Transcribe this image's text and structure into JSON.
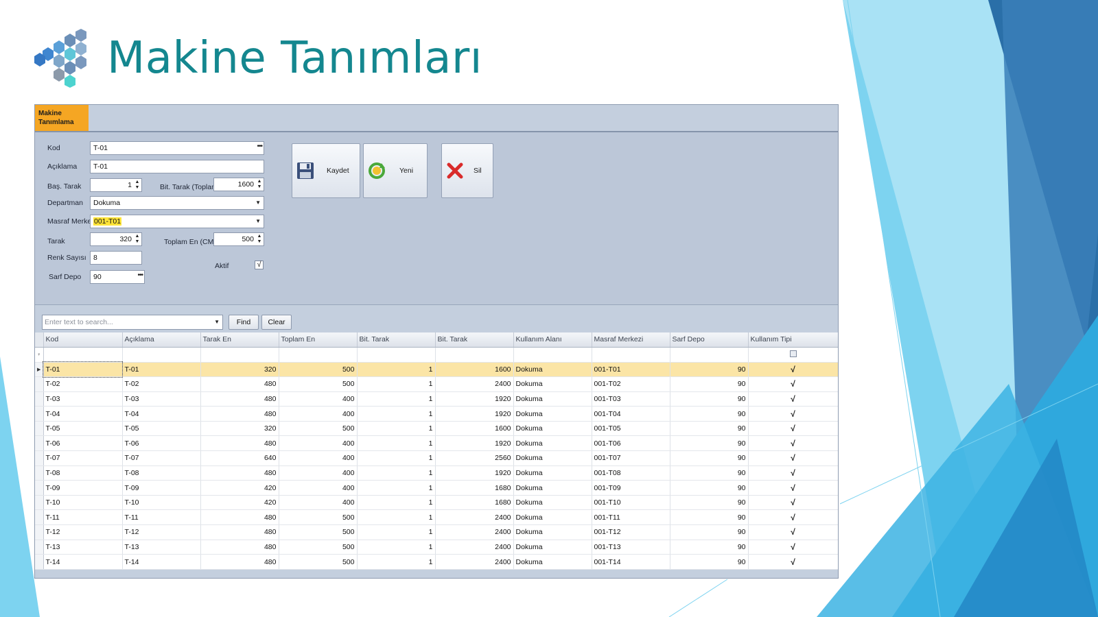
{
  "slide": {
    "title": "Makine Tanımları",
    "colors": {
      "title": "#14878f",
      "accent_light": "#7dd3f0",
      "accent_mid": "#2fa8dd",
      "accent_dark": "#2a6fa8"
    }
  },
  "app": {
    "tab_label": "Makine Tanımlama",
    "tab_color": "#f5a623",
    "form": {
      "kod_label": "Kod",
      "kod_value": "T-01",
      "aciklama_label": "Açıklama",
      "aciklama_value": "T-01",
      "bas_tarak_label": "Baş. Tarak",
      "bas_tarak_value": "1",
      "bit_tarak_label": "Bit. Tarak (Toplam)",
      "bit_tarak_value": "1600",
      "departman_label": "Departman",
      "departman_value": "Dokuma",
      "masraf_label": "Masraf Merkezi",
      "masraf_value": "001-T01",
      "tarak_label": "Tarak",
      "tarak_value": "320",
      "toplam_en_label": "Toplam En (CM)",
      "toplam_en_value": "500",
      "renk_label": "Renk Sayısı",
      "renk_value": "8",
      "aktif_label": "Aktif",
      "aktif_checked": "√",
      "sarf_label": "Sarf Depo",
      "sarf_value": "90"
    },
    "buttons": {
      "kaydet": "Kaydet",
      "yeni": "Yeni",
      "sil": "Sil"
    },
    "search": {
      "placeholder": "Enter text to search...",
      "find": "Find",
      "clear": "Clear"
    },
    "grid": {
      "columns": [
        "Kod",
        "Açıklama",
        "Tarak En",
        "Toplam En",
        "Bit. Tarak",
        "Bit. Tarak",
        "Kullanım Alanı",
        "Masraf Merkezi",
        "Sarf Depo",
        "Kullanım Tipi"
      ],
      "check_mark": "√",
      "rows": [
        [
          "T-01",
          "T-01",
          "320",
          "500",
          "1",
          "1600",
          "Dokuma",
          "001-T01",
          "90"
        ],
        [
          "T-02",
          "T-02",
          "480",
          "500",
          "1",
          "2400",
          "Dokuma",
          "001-T02",
          "90"
        ],
        [
          "T-03",
          "T-03",
          "480",
          "400",
          "1",
          "1920",
          "Dokuma",
          "001-T03",
          "90"
        ],
        [
          "T-04",
          "T-04",
          "480",
          "400",
          "1",
          "1920",
          "Dokuma",
          "001-T04",
          "90"
        ],
        [
          "T-05",
          "T-05",
          "320",
          "500",
          "1",
          "1600",
          "Dokuma",
          "001-T05",
          "90"
        ],
        [
          "T-06",
          "T-06",
          "480",
          "400",
          "1",
          "1920",
          "Dokuma",
          "001-T06",
          "90"
        ],
        [
          "T-07",
          "T-07",
          "640",
          "400",
          "1",
          "2560",
          "Dokuma",
          "001-T07",
          "90"
        ],
        [
          "T-08",
          "T-08",
          "480",
          "400",
          "1",
          "1920",
          "Dokuma",
          "001-T08",
          "90"
        ],
        [
          "T-09",
          "T-09",
          "420",
          "400",
          "1",
          "1680",
          "Dokuma",
          "001-T09",
          "90"
        ],
        [
          "T-10",
          "T-10",
          "420",
          "400",
          "1",
          "1680",
          "Dokuma",
          "001-T10",
          "90"
        ],
        [
          "T-11",
          "T-11",
          "480",
          "500",
          "1",
          "2400",
          "Dokuma",
          "001-T11",
          "90"
        ],
        [
          "T-12",
          "T-12",
          "480",
          "500",
          "1",
          "2400",
          "Dokuma",
          "001-T12",
          "90"
        ],
        [
          "T-13",
          "T-13",
          "480",
          "500",
          "1",
          "2400",
          "Dokuma",
          "001-T13",
          "90"
        ],
        [
          "T-14",
          "T-14",
          "480",
          "500",
          "1",
          "2400",
          "Dokuma",
          "001-T14",
          "90"
        ]
      ],
      "selected_row": 0
    }
  }
}
